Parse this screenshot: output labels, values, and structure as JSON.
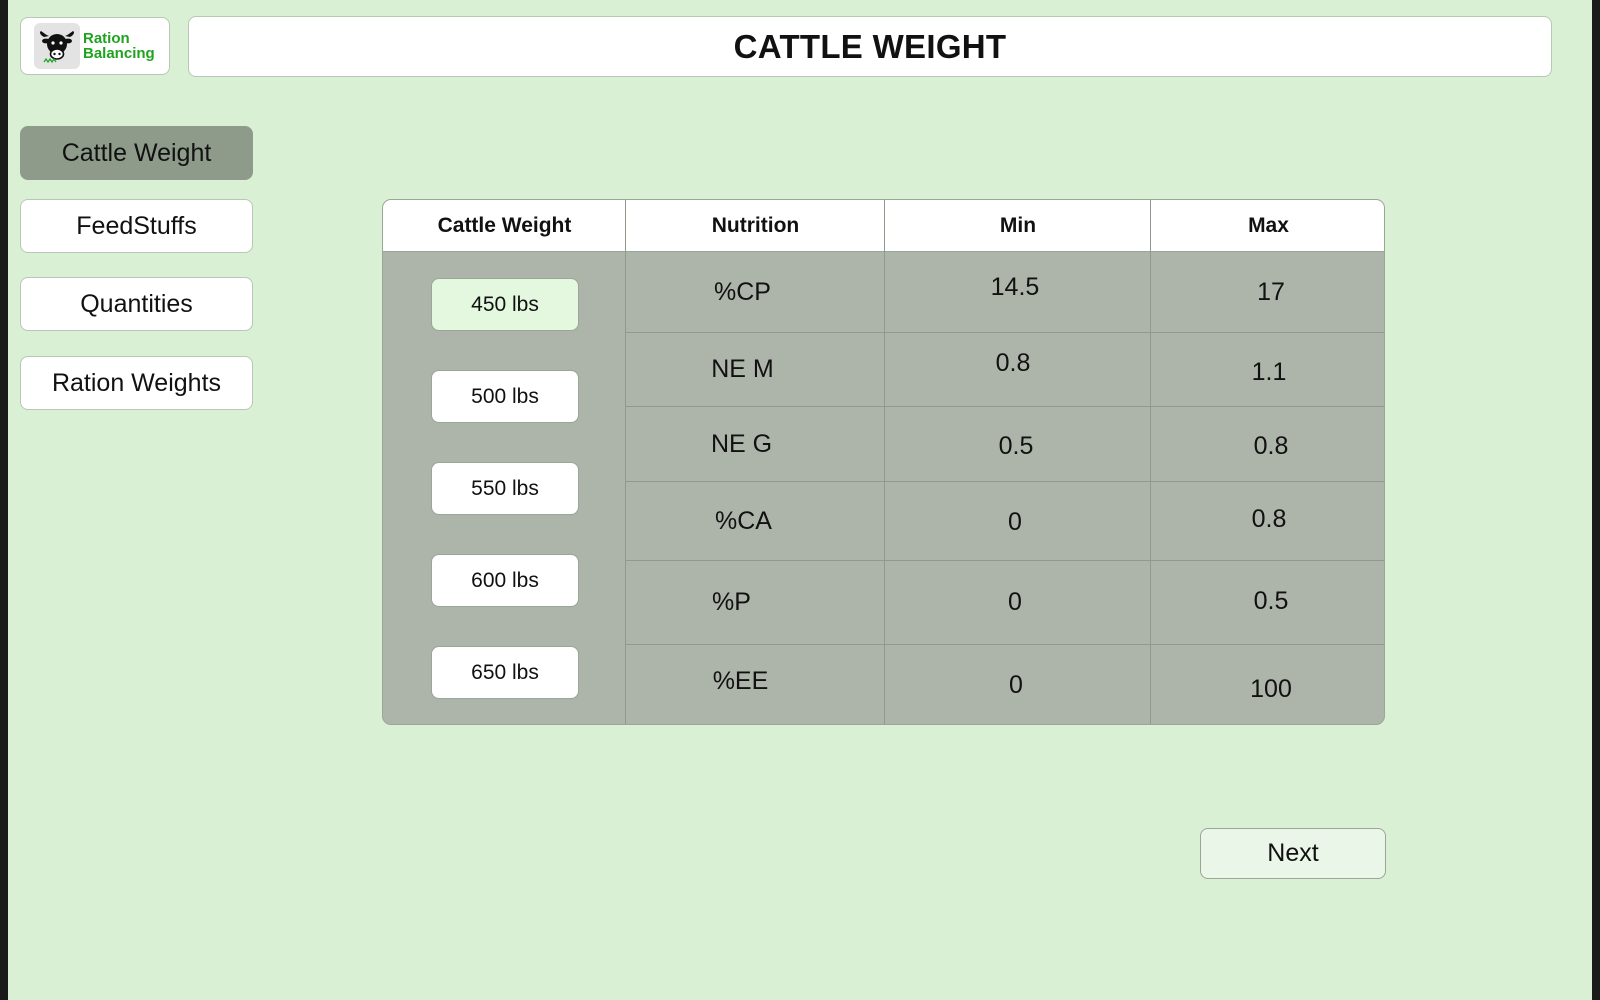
{
  "app": {
    "logo_text_line1": "Ration",
    "logo_text_line2": "Balancing",
    "logo_icon": "cow-head-icon"
  },
  "header": {
    "title": "CATTLE WEIGHT"
  },
  "sidebar": {
    "items": [
      {
        "label": "Cattle Weight",
        "active": true
      },
      {
        "label": "FeedStuffs",
        "active": false
      },
      {
        "label": "Quantities",
        "active": false
      },
      {
        "label": "Ration Weights",
        "active": false
      }
    ]
  },
  "table": {
    "headers": [
      "Cattle Weight",
      "Nutrition",
      "Min",
      "Max"
    ],
    "weights": [
      {
        "label": "450 lbs",
        "selected": true
      },
      {
        "label": "500 lbs",
        "selected": false
      },
      {
        "label": "550 lbs",
        "selected": false
      },
      {
        "label": "600 lbs",
        "selected": false
      },
      {
        "label": "650 lbs",
        "selected": false
      }
    ],
    "rows": [
      {
        "nutrition": "%CP",
        "min": "14.5",
        "max": "17"
      },
      {
        "nutrition": "NE M",
        "min": "0.8",
        "max": "1.1"
      },
      {
        "nutrition": "NE G",
        "min": "0.5",
        "max": "0.8"
      },
      {
        "nutrition": "%CA",
        "min": "0",
        "max": "0.8"
      },
      {
        "nutrition": "%P",
        "min": "0",
        "max": "0.5"
      },
      {
        "nutrition": "%EE",
        "min": "0",
        "max": "100"
      }
    ]
  },
  "footer": {
    "next_label": "Next"
  },
  "colors": {
    "background": "#d9f0d4",
    "table_body": "#adb5aa",
    "active_nav": "#8e9b8b",
    "selected_weight": "#e3f8df",
    "logo_green": "#1fa31f"
  }
}
